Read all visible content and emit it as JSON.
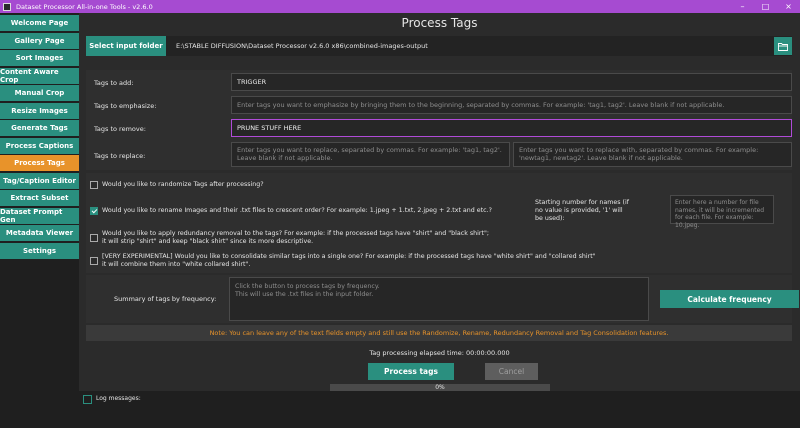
{
  "window": {
    "title": "Dataset Processor All-in-one Tools - v2.6.0",
    "controls": [
      "–",
      "□",
      "×"
    ]
  },
  "sidebar": {
    "items": [
      {
        "label": "Welcome Page"
      },
      {
        "label": "Gallery Page"
      },
      {
        "label": "Sort Images"
      },
      {
        "label": "Content Aware Crop"
      },
      {
        "label": "Manual Crop"
      },
      {
        "label": "Resize Images"
      },
      {
        "label": "Generate Tags"
      },
      {
        "label": "Process Captions"
      },
      {
        "label": "Process Tags"
      },
      {
        "label": "Tag/Caption Editor"
      },
      {
        "label": "Extract Subset"
      },
      {
        "label": "Dataset Prompt Gen"
      },
      {
        "label": "Metadata Viewer"
      },
      {
        "label": "Settings"
      }
    ],
    "active_index": 8
  },
  "main": {
    "title": "Process Tags",
    "input_folder": {
      "button_label": "Select input folder",
      "path": "E:\\STABLE DIFFUSION\\Dataset Processor v2.6.0 x86\\combined-images-output",
      "folder_icon": "folder-open-icon"
    },
    "fields": {
      "add": {
        "label": "Tags to add:",
        "value": "TRIGGER"
      },
      "emphasize": {
        "label": "Tags to emphasize:",
        "placeholder": "Enter tags you want to emphasize by bringing them to the beginning, separated by commas. For example: 'tag1, tag2'. Leave blank if not applicable."
      },
      "remove": {
        "label": "Tags to remove:",
        "value": "PRUNE STUFF HERE"
      },
      "replace": {
        "label": "Tags to replace:",
        "placeholder": "Enter tags you want to replace, separated by commas. For example: 'tag1, tag2'. Leave blank if not applicable.",
        "with_placeholder": "Enter tags you want to replace with, separated by commas. For example: 'newtag1, newtag2'. Leave blank if not applicable."
      }
    },
    "options": {
      "randomize": {
        "label": "Would you like to randomize Tags after processing?",
        "checked": false
      },
      "rename": {
        "label": "Would you like to rename Images and their .txt files to crescent order? For example: 1.jpeg + 1.txt, 2.jpeg + 2.txt and etc.?",
        "checked": true
      },
      "starting_number": {
        "label": "Starting number for names (if no value is provided, '1' will be used):",
        "placeholder": "Enter here a number for file names, it will be incremented for each file. For example: 10.jpeg."
      },
      "redundancy": {
        "label_line1": "Would you like to apply redundancy removal to the tags? For example: if the processed tags have \"shirt\" and \"black shirt\";",
        "label_line2": "it will strip \"shirt\" and keep \"black shirt\" since its more descriptive.",
        "checked": false
      },
      "consolidate": {
        "label_line1": "[VERY EXPERIMENTAL] Would you like to consolidate similar tags into a single one? For example: if the processed tags have \"white shirt\" and \"collared shirt\"",
        "label_line2": "it will combine them into \"white collared shirt\".",
        "checked": false
      }
    },
    "summary": {
      "label": "Summary of tags by frequency:",
      "placeholder_line1": "Click the button to process tags by frequency.",
      "placeholder_line2": "This will use the .txt files in the input folder.",
      "button_label": "Calculate frequency"
    },
    "note": "Note: You can leave any of the text fields empty and still use the Randomize, Rename, Redundancy Removal and Tag Consolidation features.",
    "elapsed": "Tag processing elapsed time: 00:00:00.000",
    "process_label": "Process tags",
    "cancel_label": "Cancel",
    "progress": {
      "percent": 0,
      "text": "0%"
    }
  },
  "log": {
    "label": "Log messages:"
  },
  "colors": {
    "accent": "#2a8f7f",
    "active": "#e8932a",
    "titlebar": "#a64bd1",
    "note": "#e8932a"
  }
}
